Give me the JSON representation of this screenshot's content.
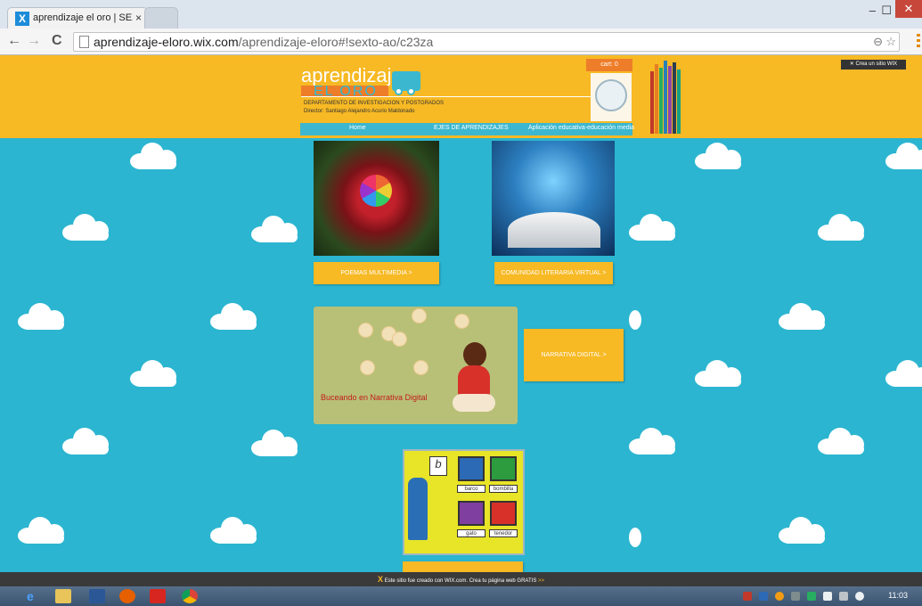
{
  "browser": {
    "tab_title": "aprendizaje el oro | SEXTO",
    "tab_close": "×",
    "favicon": "X",
    "url_domain": "aprendizaje-eloro.wix.com",
    "url_path": "/aprendizaje-eloro#!sexto-ao/c23za",
    "minimize": "–",
    "maximize": "☐",
    "close": "✕",
    "back_icon": "←",
    "forward_icon": "→",
    "reload_icon": "C",
    "zoom_icon": "⊖",
    "star_icon": "☆"
  },
  "site": {
    "logo_line1": "aprendizaje",
    "logo_line2": "EL ORO",
    "department": "DEPARTAMENTO DE INVESTIGACION Y POSTGRADOS",
    "director": "Director: Santiago Alejandro Acurio Maldonado",
    "cart": "cart: 0",
    "wix_promo": "✕ Crea un sitio WIX",
    "nav": {
      "home": "Home",
      "ejes": "EJES DE APRENDIZAJES",
      "aplicacion": "Aplicación educativa-educación media"
    }
  },
  "content": {
    "poemas_btn": "POEMAS MULTIMEDIA >",
    "comunidad_btn": "COMUNIDAD LITERARIA VIRTUAL >",
    "narrativa_caption": "Buceando en Narrativa Digital",
    "narrativa_btn": "NARRATIVA DIGITAL >",
    "kids_words": [
      "barco",
      "bombilla",
      "gato",
      "tenedor"
    ],
    "kids_letter": "b"
  },
  "wix_banner": {
    "text": "Este sitio fue creado con WIX.com. Crea tu página web GRATIS",
    "arrow": ">>"
  },
  "taskbar": {
    "clock": "11:03"
  },
  "colors": {
    "background": "#2bb5d0",
    "header": "#f7b924",
    "button": "#f7b924",
    "accent_orange": "#ee7d2a"
  }
}
